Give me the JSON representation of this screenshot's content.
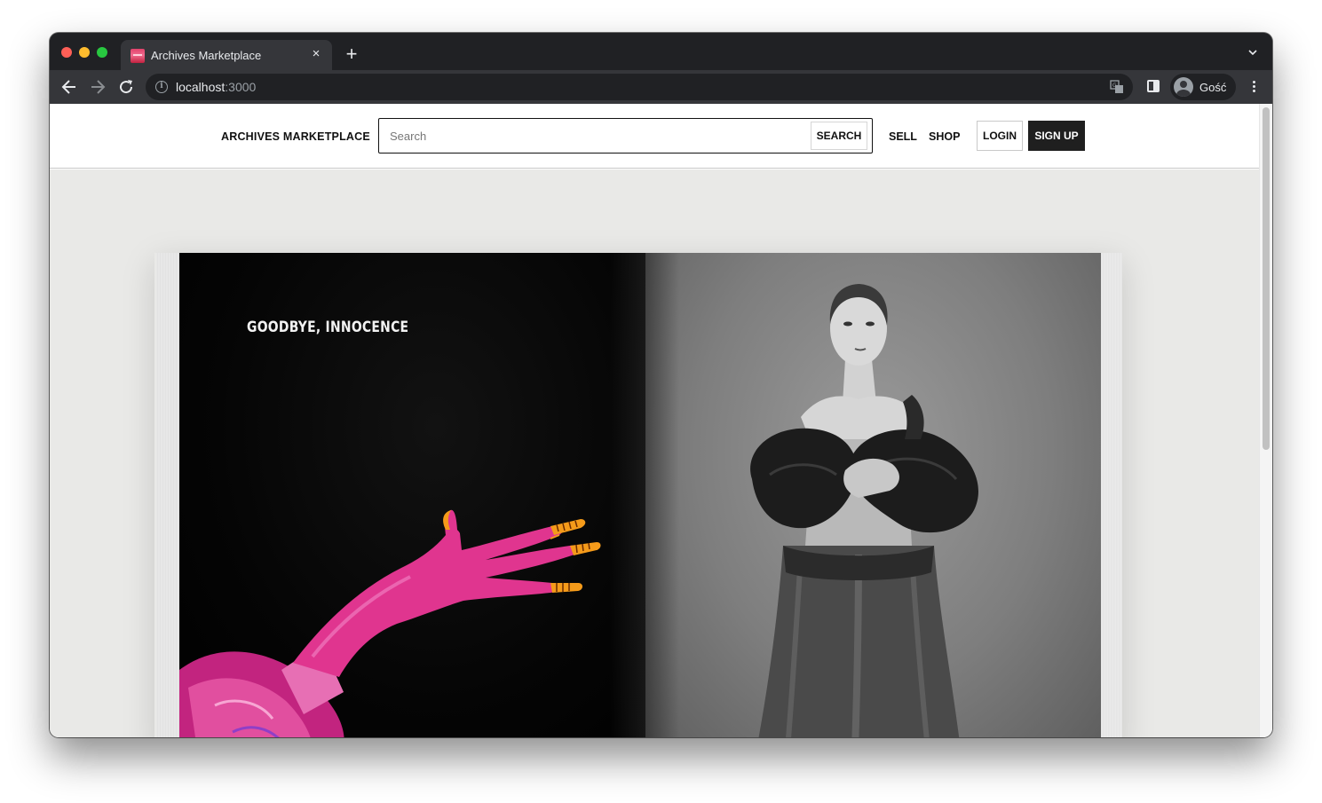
{
  "browser": {
    "tab_title": "Archives Marketplace",
    "tab_close_glyph": "×",
    "new_tab_glyph": "+",
    "url_host": "localhost",
    "url_port": ":3000",
    "profile_name": "Gość"
  },
  "site": {
    "brand": "ARCHIVES MARKETPLACE",
    "search_placeholder": "Search",
    "search_button": "SEARCH",
    "nav": {
      "sell": "SELL",
      "shop": "SHOP"
    },
    "login": "LOGIN",
    "signup": "SIGN UP"
  },
  "hero": {
    "page_heading": "GOODBYE, INNOCENCE"
  },
  "colors": {
    "signup_bg": "#1f1f1f",
    "hero_bg": "#e9e9e7",
    "hand_magenta": "#e0358f"
  },
  "icons": {
    "back": "arrow-left-icon",
    "forward": "arrow-right-icon",
    "reload": "reload-icon",
    "info": "info-icon",
    "translate": "translate-icon",
    "side_panel": "side-panel-icon",
    "menu": "kebab-menu-icon",
    "tab_search": "chevron-down-icon"
  }
}
